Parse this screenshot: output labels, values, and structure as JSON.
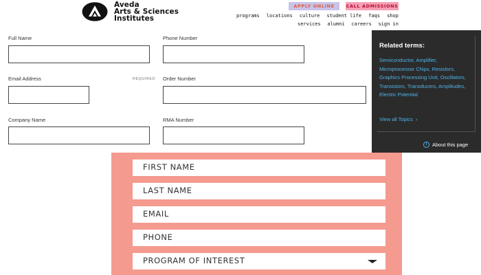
{
  "header": {
    "brand_line1": "Aveda",
    "brand_line2": "Arts & Sciences",
    "brand_line3": "Institutes",
    "apply_label": "APPLY ONLINE",
    "call_label": "CALL ADMISSIONS",
    "nav_top": [
      "programs",
      "locations",
      "culture",
      "student life",
      "faqs",
      "shop"
    ],
    "nav_bottom": [
      "services",
      "alumni",
      "careers",
      "sign in"
    ]
  },
  "form": {
    "full_name_label": "Full Name",
    "phone_label": "Phone Number",
    "email_label": "Email Address",
    "required_label": "REQUIRED",
    "order_label": "Order Number",
    "company_label": "Company Name",
    "rma_label": "RMA Number"
  },
  "related": {
    "title": "Related terms:",
    "terms": "Semiconductor, Amplifier, Microprocessor Chips, Resistors, Graphics Processing Unit, Oscillators, Transistors, Transducers, Amplitudes, Electric Potential",
    "view_all": "View all Topics",
    "about": "About this page"
  },
  "signup": {
    "first_name": "FIRST NAME",
    "last_name": "LAST NAME",
    "email": "EMAIL",
    "phone": "PHONE",
    "program": "PROGRAM OF INTEREST"
  },
  "colors": {
    "salmon_bg": "#f59a8f",
    "related_bg": "#2b2b2b",
    "link_blue": "#4fb4ea",
    "apply_bg": "#c9c3ea",
    "call_bg": "#f6a0b6"
  }
}
